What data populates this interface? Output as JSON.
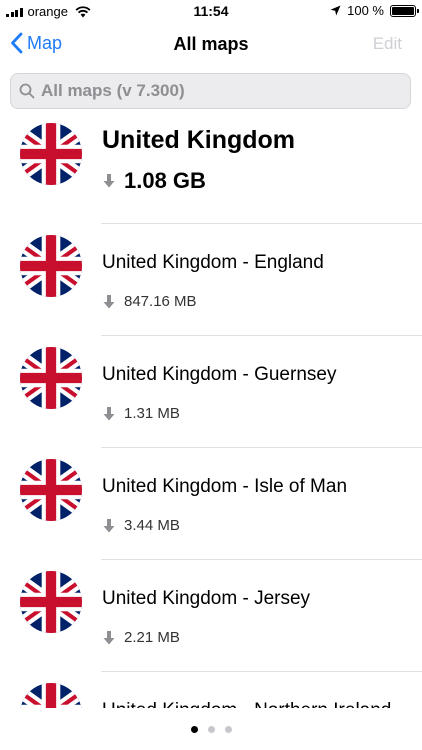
{
  "status_bar": {
    "carrier": "orange",
    "time": "11:54",
    "battery": "100 %",
    "battery_level": 1.0
  },
  "nav": {
    "back_label": "Map",
    "title": "All maps",
    "edit_label": "Edit"
  },
  "search": {
    "placeholder": "All maps (v 7.300)"
  },
  "maps": [
    {
      "name": "United Kingdom",
      "size": "1.08 GB",
      "flag": "uk-flag-icon"
    },
    {
      "name": "United Kingdom - England",
      "size": "847.16 MB",
      "flag": "uk-flag-icon"
    },
    {
      "name": "United Kingdom - Guernsey",
      "size": "1.31 MB",
      "flag": "uk-flag-icon"
    },
    {
      "name": "United Kingdom - Isle of Man",
      "size": "3.44 MB",
      "flag": "uk-flag-icon"
    },
    {
      "name": "United Kingdom - Jersey",
      "size": "2.21 MB",
      "flag": "uk-flag-icon"
    },
    {
      "name": "United Kingdom - Northern Ireland",
      "size": "",
      "flag": "uk-flag-icon"
    }
  ],
  "page_indicator": {
    "pages": 3,
    "current": 1
  },
  "colors": {
    "accent": "#1f7bf6",
    "disabled": "#cfcfd4",
    "flag_blue": "#012169",
    "flag_red": "#C8102E"
  }
}
